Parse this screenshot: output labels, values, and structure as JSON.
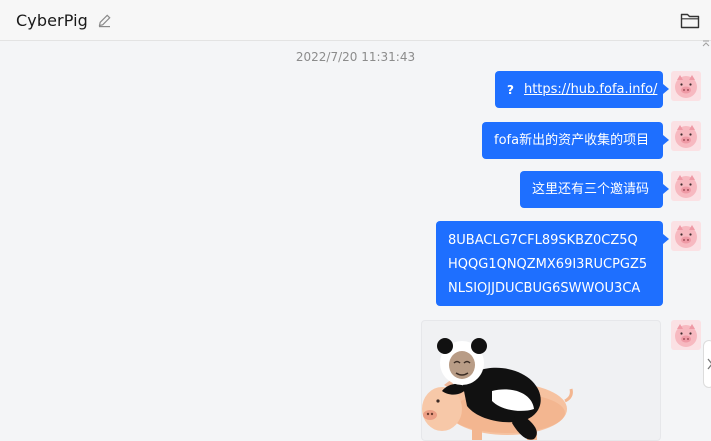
{
  "header": {
    "title": "CyberPig",
    "edit_icon": "pencil-icon",
    "folder_icon": "folder-icon"
  },
  "conversation": {
    "timestamp": "2022/7/20 11:31:43",
    "messages": [
      {
        "type": "link",
        "icon": "?",
        "text": "https://hub.fofa.info/"
      },
      {
        "type": "text",
        "text": "fofa新出的资产收集的项目"
      },
      {
        "type": "text",
        "text": "这里还有三个邀请码"
      },
      {
        "type": "multiline",
        "lines": [
          "8UBACLG7CFL89SKBZ0CZ5Q",
          "HQQG1QNQZMX69I3RUCPGZ5",
          "NLSIOJJDUCBUG6SWWOU3CA"
        ]
      },
      {
        "type": "image",
        "description_icon": "panda-riding-pig-sticker"
      }
    ]
  },
  "colors": {
    "bubble": "#1e6fff",
    "background": "#f4f5f7",
    "avatar": "#f7b9c0"
  }
}
